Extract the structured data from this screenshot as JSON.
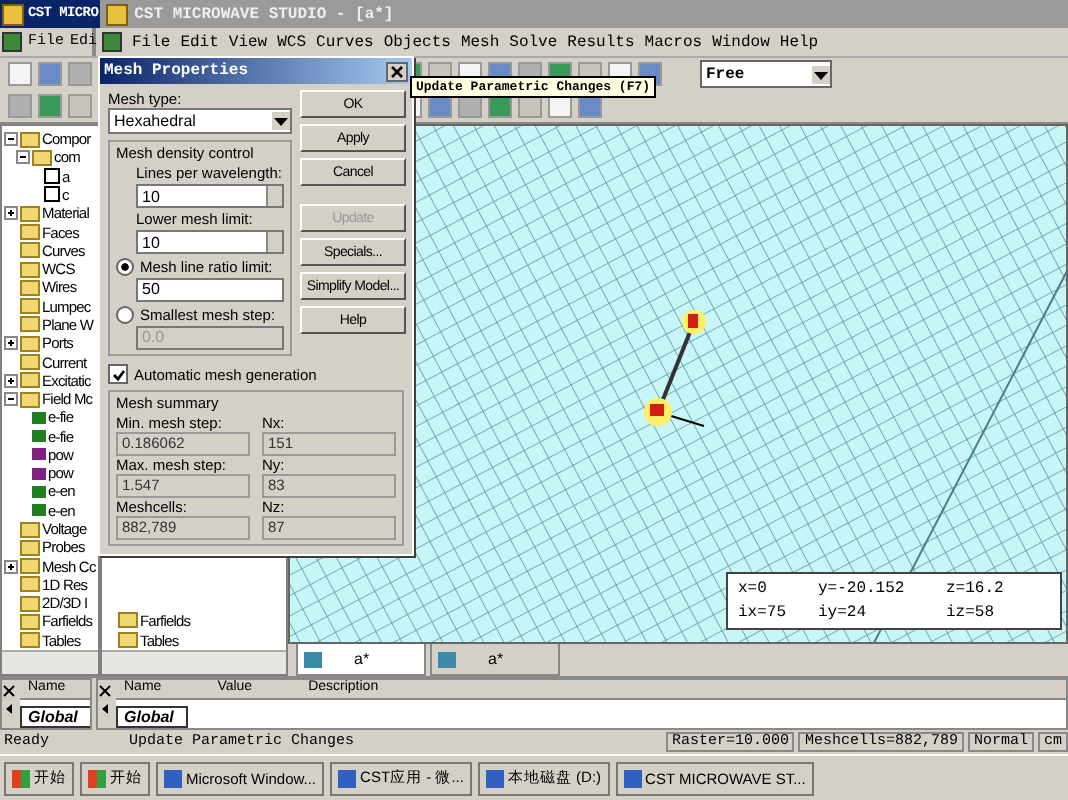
{
  "windows": [
    {
      "title": "CST MICRO"
    },
    {
      "title": "CST MICROWAVE STUDIO - [a*]"
    }
  ],
  "back_menu": [
    "File",
    "Edi"
  ],
  "menu": [
    "File",
    "Edit",
    "View",
    "WCS",
    "Curves",
    "Objects",
    "Mesh",
    "Solve",
    "Results",
    "Macros",
    "Window",
    "Help"
  ],
  "toolbar": {
    "view_mode": "Free"
  },
  "tooltip": "Update Parametric Changes (F7)",
  "tree": [
    {
      "label": "Compor",
      "expanded": true,
      "children": [
        {
          "label": "com",
          "expanded": true,
          "children": [
            {
              "label": "a"
            },
            {
              "label": "c"
            }
          ]
        }
      ]
    },
    {
      "label": "Material",
      "expanded": false
    },
    {
      "label": "Faces"
    },
    {
      "label": "Curves"
    },
    {
      "label": "WCS"
    },
    {
      "label": "Wires"
    },
    {
      "label": "Lumpec"
    },
    {
      "label": "Plane W"
    },
    {
      "label": "Ports",
      "expanded": false
    },
    {
      "label": "Current"
    },
    {
      "label": "Excitatic",
      "expanded": false
    },
    {
      "label": "Field Mc",
      "expanded": true,
      "children": [
        {
          "label": "e-fie",
          "color": "#208020"
        },
        {
          "label": "e-fie",
          "color": "#208020"
        },
        {
          "label": "pow",
          "color": "#802080"
        },
        {
          "label": "pow",
          "color": "#802080"
        },
        {
          "label": "e-en",
          "color": "#208020"
        },
        {
          "label": "e-en",
          "color": "#208020"
        }
      ]
    },
    {
      "label": "Voltage"
    },
    {
      "label": "Probes"
    },
    {
      "label": "Mesh Cc",
      "expanded": false
    },
    {
      "label": "1D Res"
    },
    {
      "label": "2D/3D I"
    },
    {
      "label": "Farfields"
    },
    {
      "label": "Tables"
    }
  ],
  "tree2": [
    "Farfields",
    "Tables"
  ],
  "dialog": {
    "title": "Mesh Properties",
    "mesh_type_label": "Mesh type:",
    "mesh_type": "Hexahedral",
    "density_title": "Mesh density control",
    "lines_label": "Lines per wavelength:",
    "lines_value": "10",
    "lower_label": "Lower mesh limit:",
    "lower_value": "10",
    "radios": [
      {
        "label": "Mesh line ratio limit:",
        "value": "50",
        "selected": true
      },
      {
        "label": "Smallest mesh step:",
        "value": "0.0",
        "selected": false
      }
    ],
    "auto": {
      "label": "Automatic mesh generation",
      "checked": true
    },
    "summary_title": "Mesh summary",
    "summary": [
      {
        "label": "Min. mesh step:",
        "value": "0.186062"
      },
      {
        "label": "Nx:",
        "value": "151"
      },
      {
        "label": "Max. mesh step:",
        "value": "1.547"
      },
      {
        "label": "Ny:",
        "value": "83"
      },
      {
        "label": "Meshcells:",
        "value": "882,789"
      },
      {
        "label": "Nz:",
        "value": "87"
      }
    ],
    "buttons": [
      {
        "label": "OK",
        "disabled": false
      },
      {
        "label": "Apply",
        "disabled": false
      },
      {
        "label": "Cancel",
        "disabled": false
      },
      {
        "label": "Update",
        "disabled": true
      },
      {
        "label": "Specials...",
        "disabled": false
      },
      {
        "label": "Simplify Model...",
        "disabled": false
      },
      {
        "label": "Help",
        "disabled": false
      }
    ]
  },
  "coords": [
    "x=0",
    "y=-20.152",
    "z=16.2",
    "ix=75",
    "iy=24",
    "iz=58"
  ],
  "view_tabs": [
    {
      "label": "a*",
      "selected": true
    },
    {
      "label": "a*",
      "selected": false
    }
  ],
  "param_panes": [
    {
      "tab": "Global",
      "headers": [
        "Name"
      ]
    },
    {
      "tab": "Global",
      "headers": [
        "Name",
        "Value",
        "Description"
      ]
    }
  ],
  "status_left": [
    "Ready",
    "Update Parametric Changes"
  ],
  "status_right": [
    "Raster=10.000",
    "Meshcells=882,789",
    "Normal",
    "cm"
  ],
  "taskbar": [
    {
      "label": "开始",
      "kind": "start"
    },
    {
      "label": "开始",
      "kind": "start"
    },
    {
      "label": "Microsoft Window...",
      "kind": "task"
    },
    {
      "label": "CST应用 - 微...",
      "kind": "task"
    },
    {
      "label": "本地磁盘 (D:)",
      "kind": "task"
    },
    {
      "label": "CST MICROWAVE ST...",
      "kind": "task"
    }
  ]
}
